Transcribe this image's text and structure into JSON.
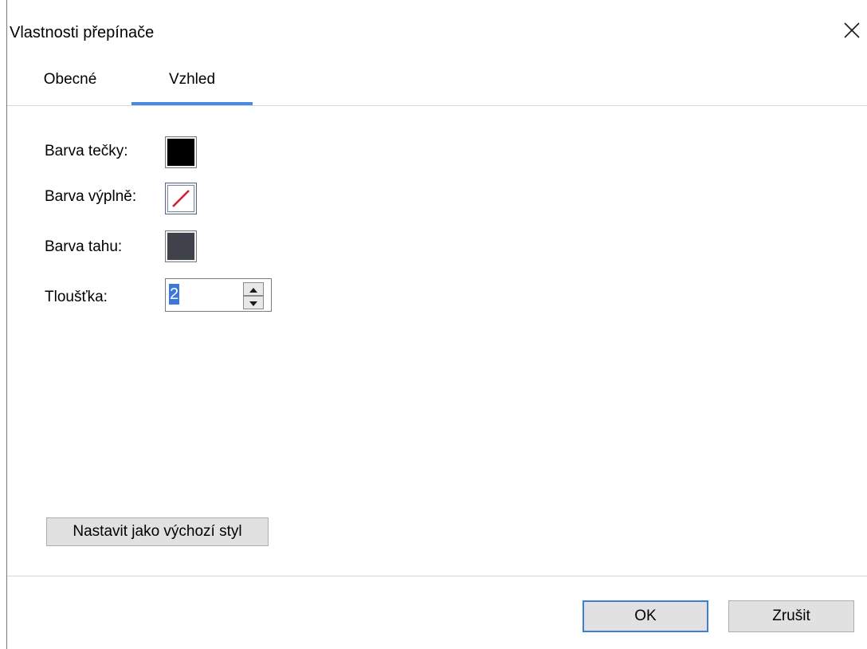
{
  "window": {
    "title": "Vlastnosti přepínače",
    "close_icon": "close-icon"
  },
  "tabs": [
    {
      "label": "Obecné",
      "selected": false
    },
    {
      "label": "Vzhled",
      "selected": true
    }
  ],
  "appearance": {
    "dot_color": {
      "label": "Barva tečky:",
      "value": "#000000"
    },
    "fill_color": {
      "label": "Barva výplně:",
      "value": "none",
      "icon": "no-color-icon"
    },
    "stroke_color": {
      "label": "Barva tahu:",
      "value": "#3f424a"
    },
    "thickness": {
      "label": "Tloušťka:",
      "value": "2"
    }
  },
  "buttons": {
    "set_default_style": "Nastavit jako výchozí styl",
    "ok": "OK",
    "cancel": "Zrušit"
  },
  "colors": {
    "accent": "#4a8be0",
    "no_color_slash": "#d0213a"
  }
}
